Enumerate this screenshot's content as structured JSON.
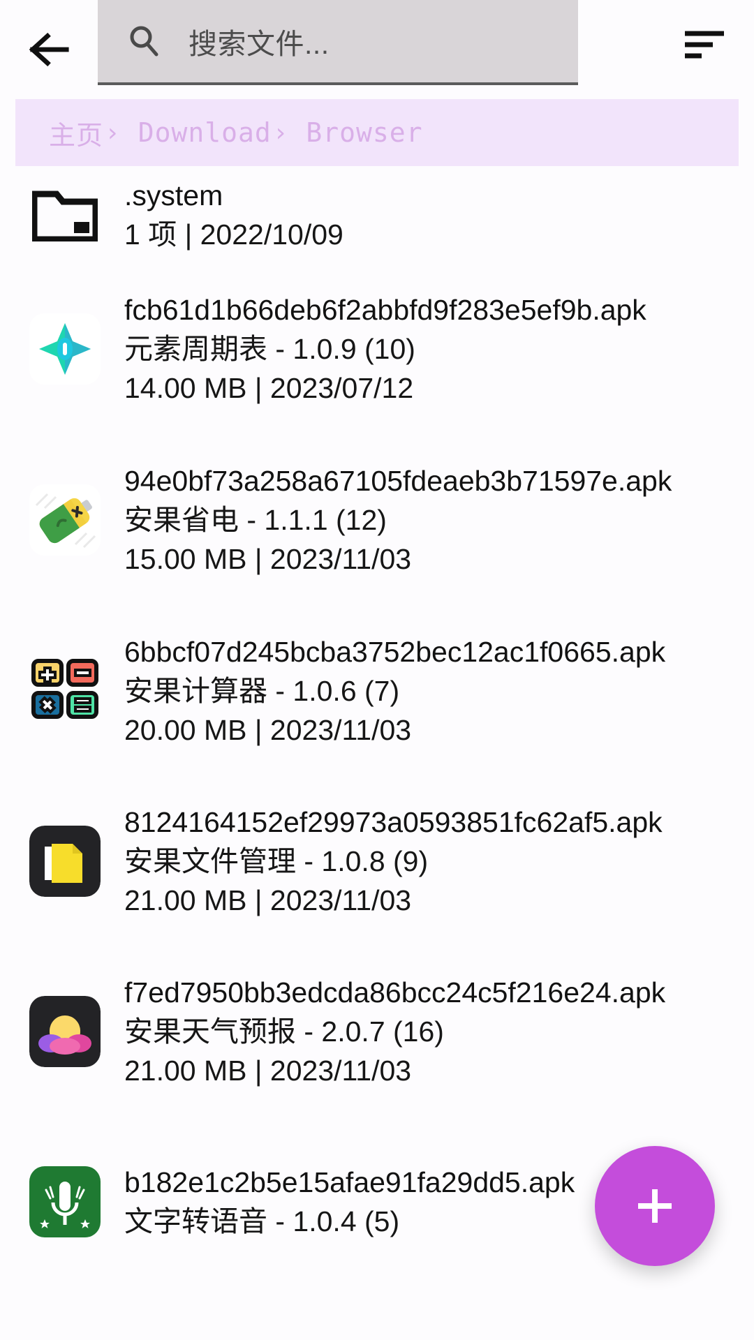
{
  "topbar": {
    "back_icon": "arrow-left-icon",
    "search": {
      "icon": "search-icon",
      "value": "",
      "placeholder": "搜索文件..."
    },
    "sort_icon": "sort-icon"
  },
  "breadcrumb": {
    "separator": "›",
    "items": [
      {
        "label": "主页"
      },
      {
        "label": "Download"
      },
      {
        "label": "Browser"
      }
    ]
  },
  "files": [
    {
      "icon": "folder-icon",
      "name": ".system",
      "subtitle": null,
      "meta": "1 项 | 2022/10/09"
    },
    {
      "icon": "app-periodic-table-icon",
      "name": "fcb61d1b66deb6f2abbfd9f283e5ef9b.apk",
      "subtitle": "元素周期表 - 1.0.9 (10)",
      "meta": "14.00 MB | 2023/07/12"
    },
    {
      "icon": "app-battery-saver-icon",
      "name": "94e0bf73a258a67105fdeaeb3b71597e.apk",
      "subtitle": "安果省电 - 1.1.1 (12)",
      "meta": "15.00 MB | 2023/11/03"
    },
    {
      "icon": "app-calculator-icon",
      "name": "6bbcf07d245bcba3752bec12ac1f0665.apk",
      "subtitle": "安果计算器 - 1.0.6 (7)",
      "meta": "20.00 MB | 2023/11/03"
    },
    {
      "icon": "app-file-manager-icon",
      "name": "8124164152ef29973a0593851fc62af5.apk",
      "subtitle": "安果文件管理 - 1.0.8 (9)",
      "meta": "21.00 MB | 2023/11/03"
    },
    {
      "icon": "app-weather-icon",
      "name": "f7ed7950bb3edcda86bcc24c5f216e24.apk",
      "subtitle": "安果天气预报 - 2.0.7 (16)",
      "meta": "21.00 MB | 2023/11/03"
    },
    {
      "icon": "app-text-to-speech-icon",
      "name": "b182e1c2b5e15afae91fa29dd5.apk",
      "subtitle": "文字转语音 - 1.0.4 (5)",
      "meta": ""
    }
  ],
  "fab": {
    "icon": "plus-icon",
    "label": "+"
  },
  "colors": {
    "accent": "#c44ddb",
    "breadcrumb_bg": "#f2e4fb",
    "breadcrumb_text": "#d9afe8",
    "search_bg": "#d9d5d8",
    "page_bg": "#fdfcfe"
  }
}
